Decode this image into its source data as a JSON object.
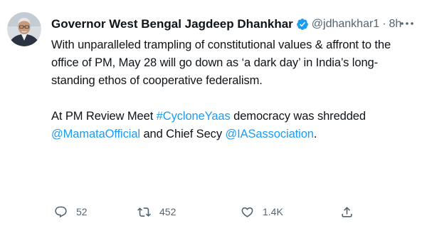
{
  "tweet": {
    "author_name": "Governor West Bengal Jagdeep Dhankhar",
    "handle": "@jdhankhar1",
    "separator": "·",
    "time": "8h",
    "paragraph1": "With unparalleled trampling of constitutional values & affront to the office of PM, May 28 will go down as ‘a dark day’ in India’s long-standing ethos of cooperative federalism.",
    "paragraph2": {
      "prefix": "At PM Review Meet ",
      "hashtag": "#CycloneYaas",
      "middle": " democracy was shredded ",
      "mention1": "@MamataOfficial",
      "connector": " and Chief Secy ",
      "mention2": "@IASassociation",
      "suffix": "."
    },
    "stats": {
      "replies": "52",
      "retweets": "452",
      "likes": "1.4K"
    }
  },
  "colors": {
    "text": "#0f1419",
    "secondary": "#536471",
    "link": "#1d9bf0",
    "verified": "#1d9bf0"
  },
  "icons": {
    "avatar": "avatar",
    "verified": "verified-badge-icon",
    "more": "more-options-icon",
    "reply": "reply-icon",
    "retweet": "retweet-icon",
    "like": "heart-icon",
    "share": "share-icon"
  }
}
